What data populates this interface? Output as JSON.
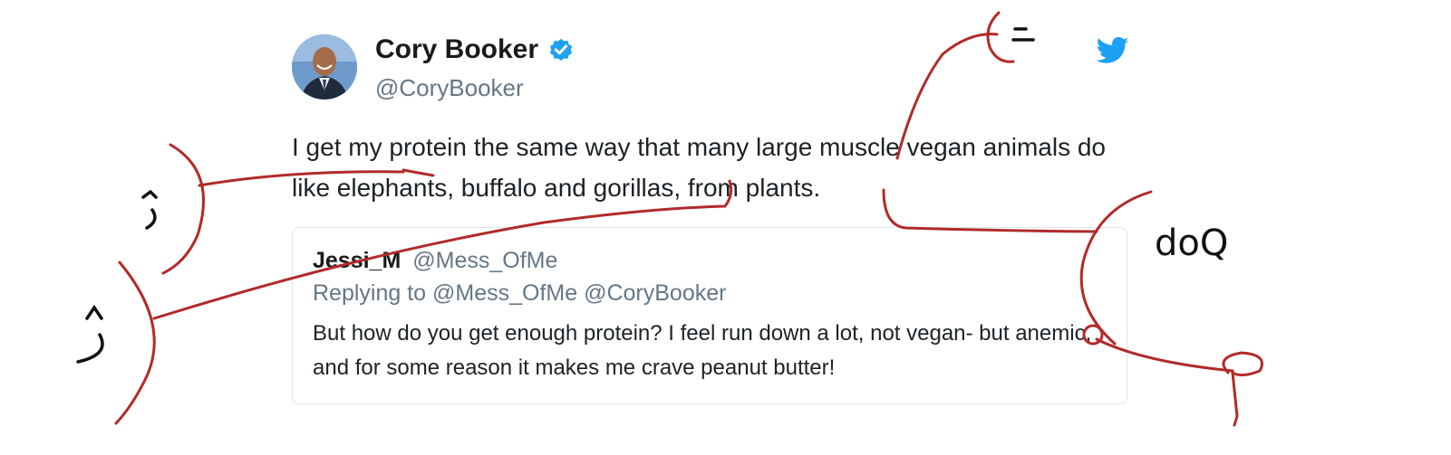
{
  "tweet": {
    "author_name": "Cory Booker",
    "author_handle": "@CoryBooker",
    "verified": true,
    "text": "I get my protein the same way that many large muscle vegan animals do like elephants, buffalo and gorillas, from plants.",
    "platform_icon": "twitter-bird-icon",
    "brand_color": "#1da1f2"
  },
  "quoted": {
    "author_name": "Jessi_M",
    "author_handle": "@Mess_OfMe",
    "reply_line": "Replying to @Mess_OfMe @CoryBooker",
    "text": "But how do you get enough protein? I feel run down a lot, not vegan- but anemic, and for some reason it makes me crave peanut butter!"
  },
  "annotations": {
    "ink_color": "#b22a2a",
    "handwritten_note": "doQ"
  }
}
